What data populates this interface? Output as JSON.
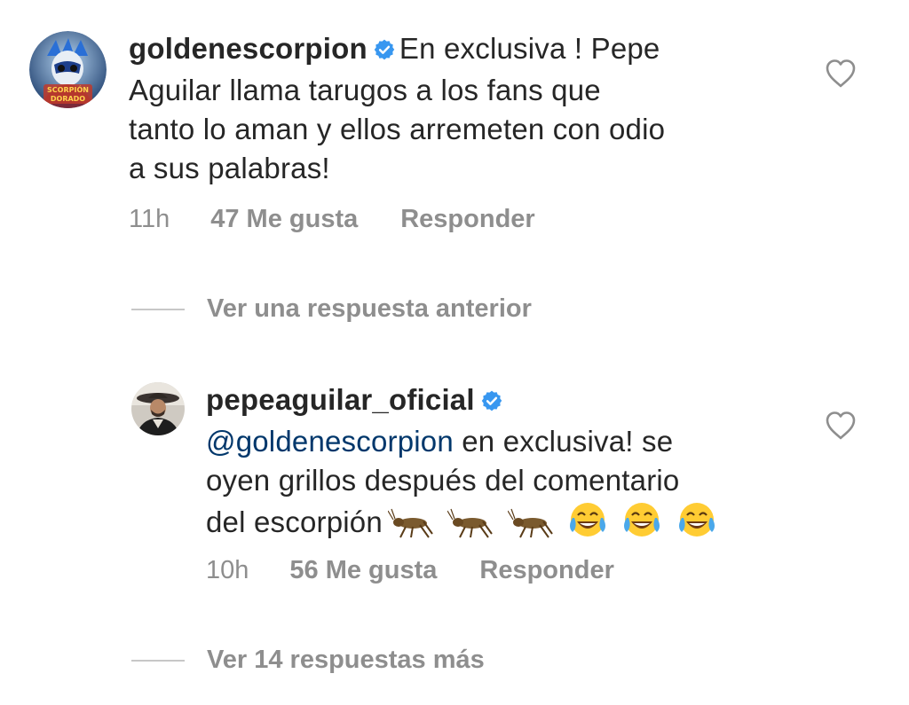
{
  "comments": [
    {
      "username": "goldenescorpion",
      "verified": true,
      "avatar_text_line1": "SCORPIÓN",
      "avatar_text_line2": "DORADO",
      "text_parts": [
        "En exclusiva ! Pepe",
        "Aguilar llama tarugos a los fans que",
        "tanto lo aman y ellos arremeten con odio",
        "a sus palabras!"
      ],
      "time": "11h",
      "likes": "47 Me gusta",
      "reply_label": "Responder"
    },
    {
      "username": "pepeaguilar_oficial",
      "verified": true,
      "mention": "@goldenescorpion",
      "text_after_mention": " en exclusiva!  se",
      "text_line2": "oyen grillos después del comentario",
      "text_line3": "del escorpión",
      "emojis": [
        "cricket-icon",
        "cricket-icon",
        "cricket-icon",
        "tears-of-joy-icon",
        "tears-of-joy-icon",
        "tears-of-joy-icon"
      ],
      "time": "10h",
      "likes": "56 Me gusta",
      "reply_label": "Responder"
    }
  ],
  "replies_links": {
    "previous": "Ver una respuesta anterior",
    "more": "Ver 14 respuestas más"
  },
  "colors": {
    "text": "#262626",
    "secondary": "#8e8e8e",
    "mention": "#00376b",
    "verified": "#3897f0"
  }
}
